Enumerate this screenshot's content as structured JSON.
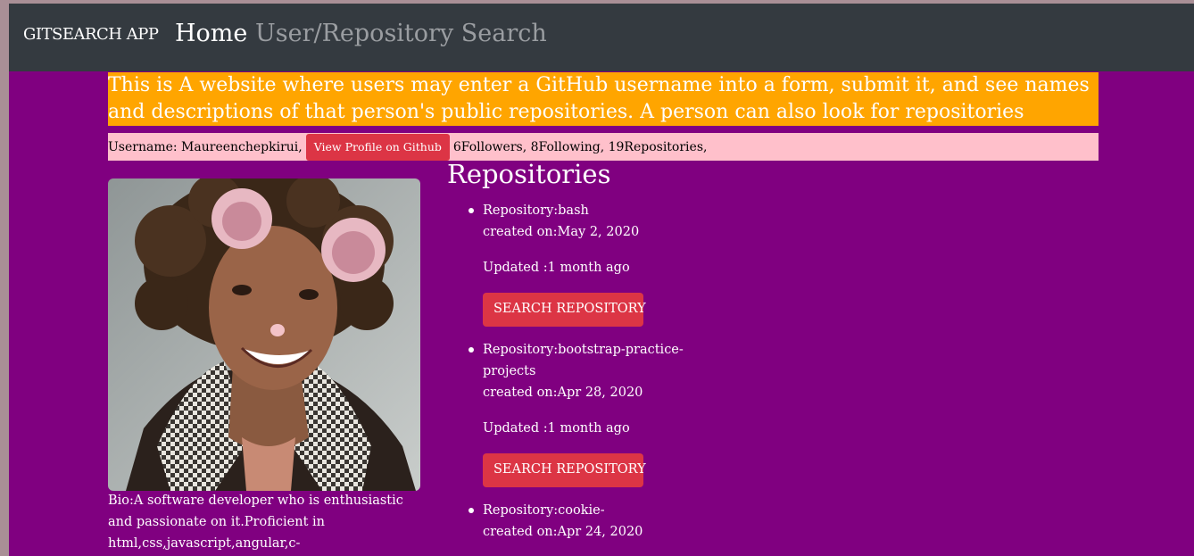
{
  "navbar": {
    "brand": "GITSEARCH APP",
    "home": "Home",
    "search": "User/Repository Search"
  },
  "intro": {
    "text": "This is A website where users may enter a GitHub username into a form, submit it, and see names and descriptions of that person's public repositories. A person can also look for repositories"
  },
  "user": {
    "username_label": "Username: Maureenchepkirui,",
    "profile_button": "View Profile on Github",
    "stats": "6Followers, 8Following, 19Repositories,",
    "bio": "Bio:A software developer who is enthusiastic and passionate on it.Proficient in html,css,javascript,angular,c-"
  },
  "repos": {
    "title": "Repositories",
    "items": [
      {
        "name": "Repository:bash",
        "created": "created on:May 2, 2020",
        "updated": "Updated :1 month ago",
        "button": "SEARCH REPOSITORY"
      },
      {
        "name": "Repository:bootstrap-practice-projects",
        "created": "created on:Apr 28, 2020",
        "updated": "Updated :1 month ago",
        "button": "SEARCH REPOSITORY"
      },
      {
        "name": "Repository:cookie-",
        "created": "created on:Apr 24, 2020"
      }
    ]
  },
  "colors": {
    "navbar": "#343a40",
    "page_bg": "#800080",
    "intro_bg": "#ffa500",
    "userbar_bg": "#ffc0cb",
    "button_red": "#dc3545"
  }
}
